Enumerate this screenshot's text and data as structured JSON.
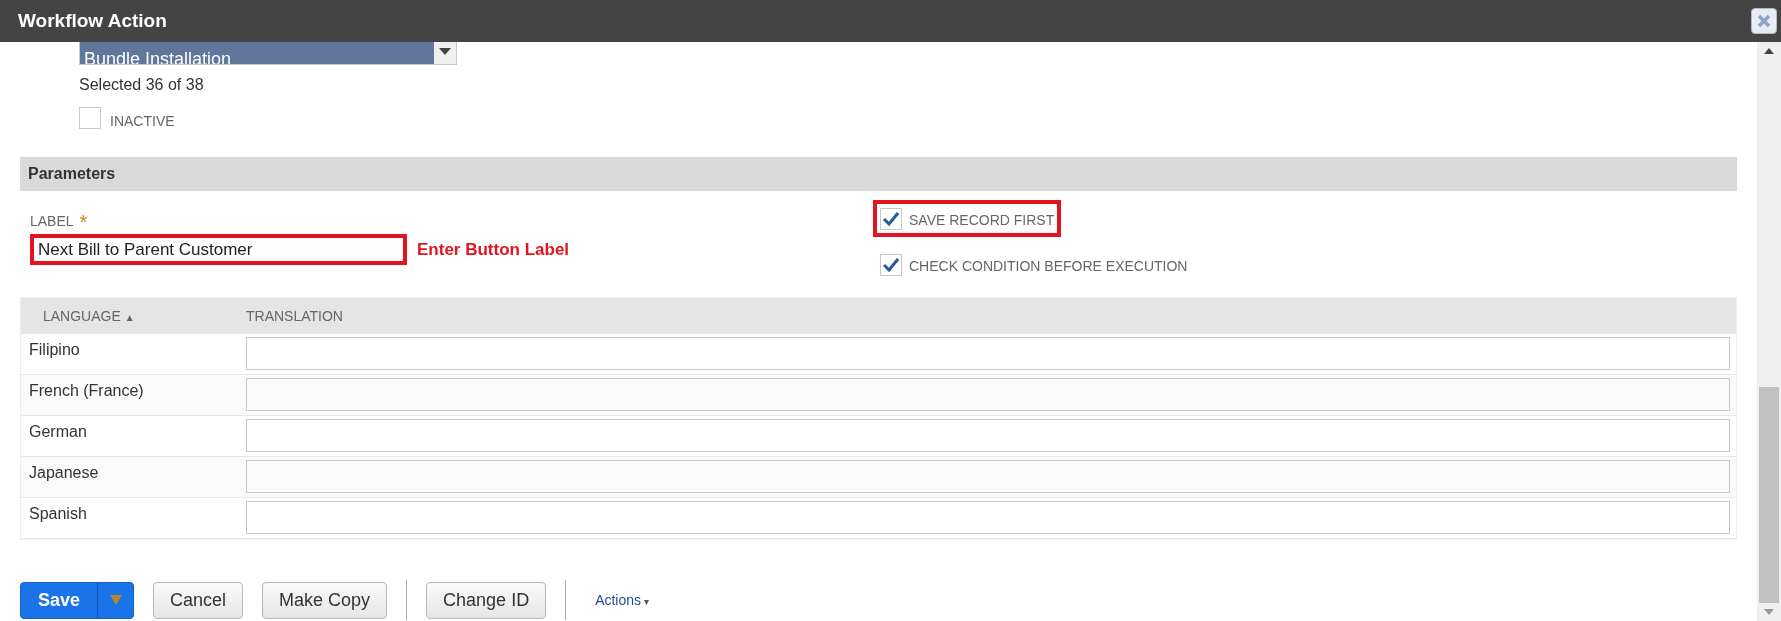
{
  "window": {
    "title": "Workflow Action"
  },
  "select": {
    "value": "Bundle Installation"
  },
  "selected_count": "Selected 36 of 38",
  "inactive": {
    "label": "INACTIVE",
    "checked": false
  },
  "section": {
    "title": "Parameters"
  },
  "label_field": {
    "label": "LABEL",
    "required_mark": "*",
    "value": "Next Bill to Parent Customer",
    "highlighted": true,
    "annotation": "Enter Button Label"
  },
  "options": [
    {
      "label": "SAVE RECORD FIRST",
      "checked": true,
      "highlighted": true
    },
    {
      "label": "CHECK CONDITION BEFORE EXECUTION",
      "checked": true,
      "highlighted": false
    }
  ],
  "table": {
    "columns": [
      {
        "label": "LANGUAGE",
        "sort_icon": "▲"
      },
      {
        "label": "TRANSLATION"
      }
    ],
    "rows": [
      {
        "language": "Filipino"
      },
      {
        "language": "French (France)"
      },
      {
        "language": "German"
      },
      {
        "language": "Japanese"
      },
      {
        "language": "Spanish"
      }
    ]
  },
  "buttons": [
    {
      "label": "Save",
      "kind": "primary"
    },
    {
      "label": "Cancel",
      "kind": "default"
    },
    {
      "label": "Make Copy",
      "kind": "default"
    },
    {
      "kind": "divider"
    },
    {
      "label": "Change ID",
      "kind": "default"
    },
    {
      "kind": "divider"
    },
    {
      "label": "Actions",
      "kind": "link",
      "caret": "▾"
    }
  ]
}
